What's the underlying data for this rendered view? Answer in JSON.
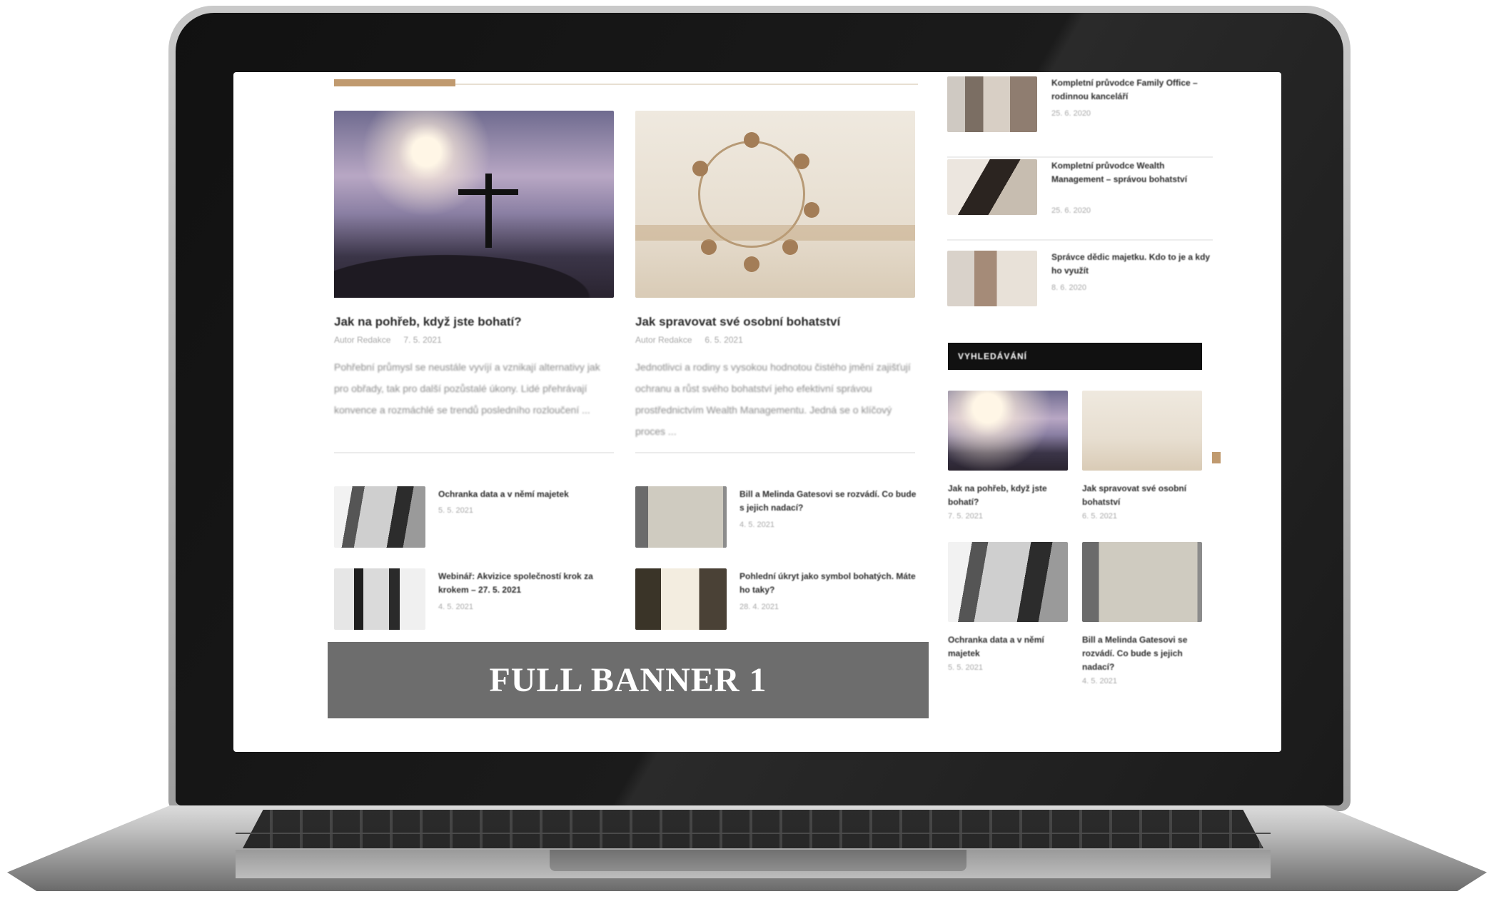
{
  "feature_articles": [
    {
      "title": "Jak na pohřeb, když jste bohatí?",
      "author": "Autor Redakce",
      "date": "7. 5. 2021",
      "excerpt": "Pohřební průmysl se neustále vyvíjí a vznikají alternativy jak pro obřady, tak pro další pozůstalé úkony. Lidé přehrávají konvence a rozmáchlé se trendů posledního rozloučení ..."
    },
    {
      "title": "Jak spravovat své osobní bohatství",
      "author": "Autor Redakce",
      "date": "6. 5. 2021",
      "excerpt": "Jednotlivci a rodiny s vysokou hodnotou čistého jmění zajišťují ochranu a růst svého bohatství jeho efektivní správou prostřednictvím Wealth Managementu. Jedná se o klíčový proces ..."
    }
  ],
  "small_articles": [
    {
      "title": "Ochranka data a v němí majetek",
      "date": "5. 5. 2021"
    },
    {
      "title": "Bill a Melinda Gatesovi se rozvádí. Co bude s jejich nadací?",
      "date": "4. 5. 2021"
    },
    {
      "title": "Webinář: Akvizice společností krok za krokem – 27. 5. 2021",
      "date": "4. 5. 2021"
    },
    {
      "title": "Pohlední úkryt jako symbol bohatých. Máte ho taky?",
      "date": "28. 4. 2021"
    }
  ],
  "banner": {
    "label": "FULL BANNER 1"
  },
  "sidebar_top": [
    {
      "title": "Kompletní průvodce Family Office – rodinnou kanceláří",
      "date": "25. 6. 2020"
    },
    {
      "title": "Kompletní průvodce Wealth Management – správou bohatství",
      "date": "25. 6. 2020"
    },
    {
      "title": "Správce dědic majetku. Kdo to je a kdy ho využít",
      "date": "8. 6. 2020"
    }
  ],
  "widget": {
    "header": "VYHLEDÁVÁNÍ",
    "items": [
      {
        "title": "Jak na pohřeb, když jste bohatí?",
        "date": "7. 5. 2021"
      },
      {
        "title": "Jak spravovat své osobní bohatství",
        "date": "6. 5. 2021"
      },
      {
        "title": "Ochranka data a v němí majetek",
        "date": "5. 5. 2021"
      },
      {
        "title": "Bill a Melinda Gatesovi se rozvádí. Co bude s jejich nadací?",
        "date": "4. 5. 2021"
      }
    ]
  },
  "colors": {
    "accent": "#c09a6f",
    "banner_bg": "#6d6d6d",
    "widget_header_bg": "#111111"
  }
}
